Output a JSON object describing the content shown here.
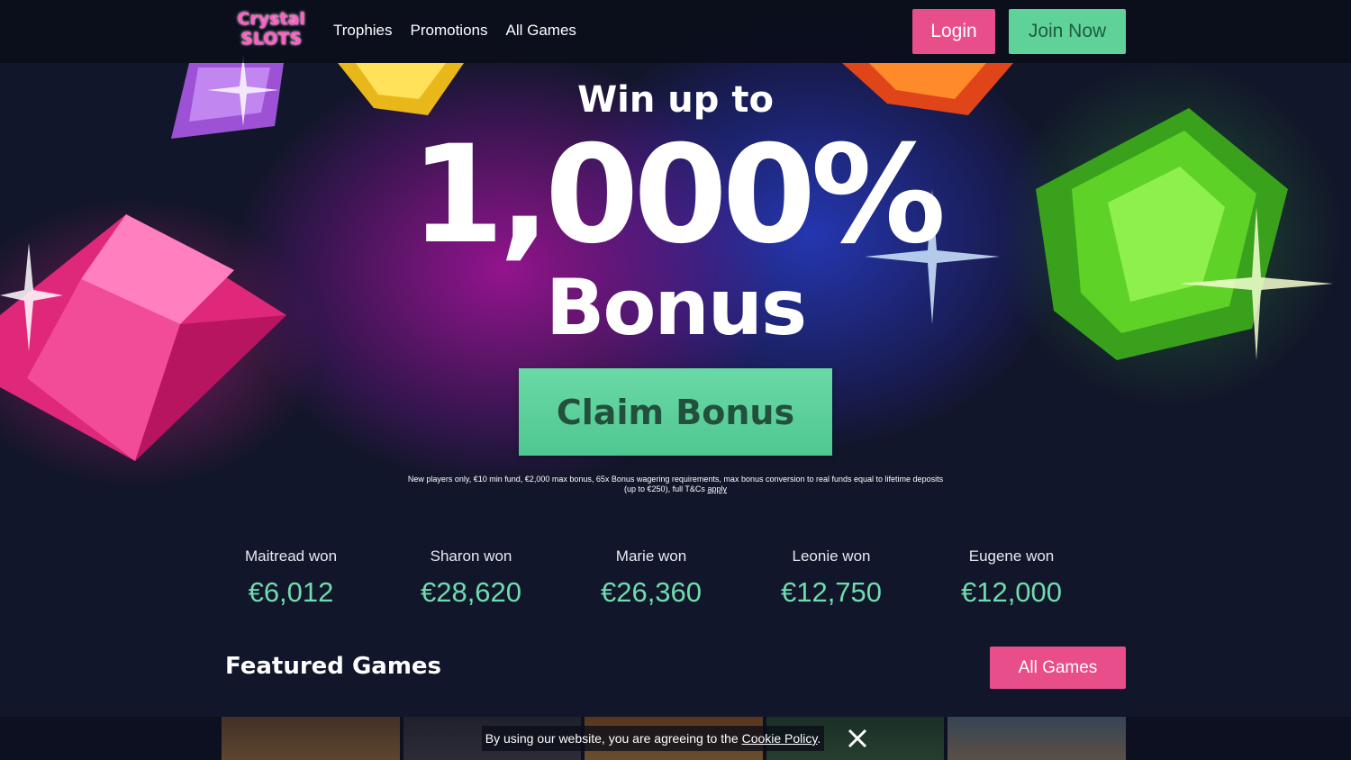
{
  "header": {
    "logo_line1": "Crystal",
    "logo_line2": "SLOTS",
    "nav": [
      "Trophies",
      "Promotions",
      "All Games"
    ],
    "login_label": "Login",
    "join_label": "Join Now"
  },
  "hero": {
    "win_up_to": "Win up to",
    "percent": "1,000%",
    "bonus": "Bonus",
    "claim_label": "Claim Bonus",
    "terms_text": "New players only, €10 min fund, €2,000 max bonus, 65x Bonus wagering requirements, max bonus conversion to real funds equal to lifetime deposits (up to €250), full T&Cs",
    "terms_link": "apply"
  },
  "winners": [
    {
      "name": "Maitread won",
      "amount": "€6,012"
    },
    {
      "name": "Sharon won",
      "amount": "€28,620"
    },
    {
      "name": "Marie won",
      "amount": "€26,360"
    },
    {
      "name": "Leonie won",
      "amount": "€12,750"
    },
    {
      "name": "Eugene won",
      "amount": "€12,000"
    }
  ],
  "featured": {
    "title": "Featured Games",
    "all_games_label": "All Games"
  },
  "cookie": {
    "text": "By using our website, you are agreeing to the",
    "link": "Cookie Policy",
    "suffix": "."
  },
  "colors": {
    "pink_button": "#e84e8a",
    "green_button": "#5fd29a",
    "winner_amount": "#6fdcae",
    "background": "#12162a"
  }
}
